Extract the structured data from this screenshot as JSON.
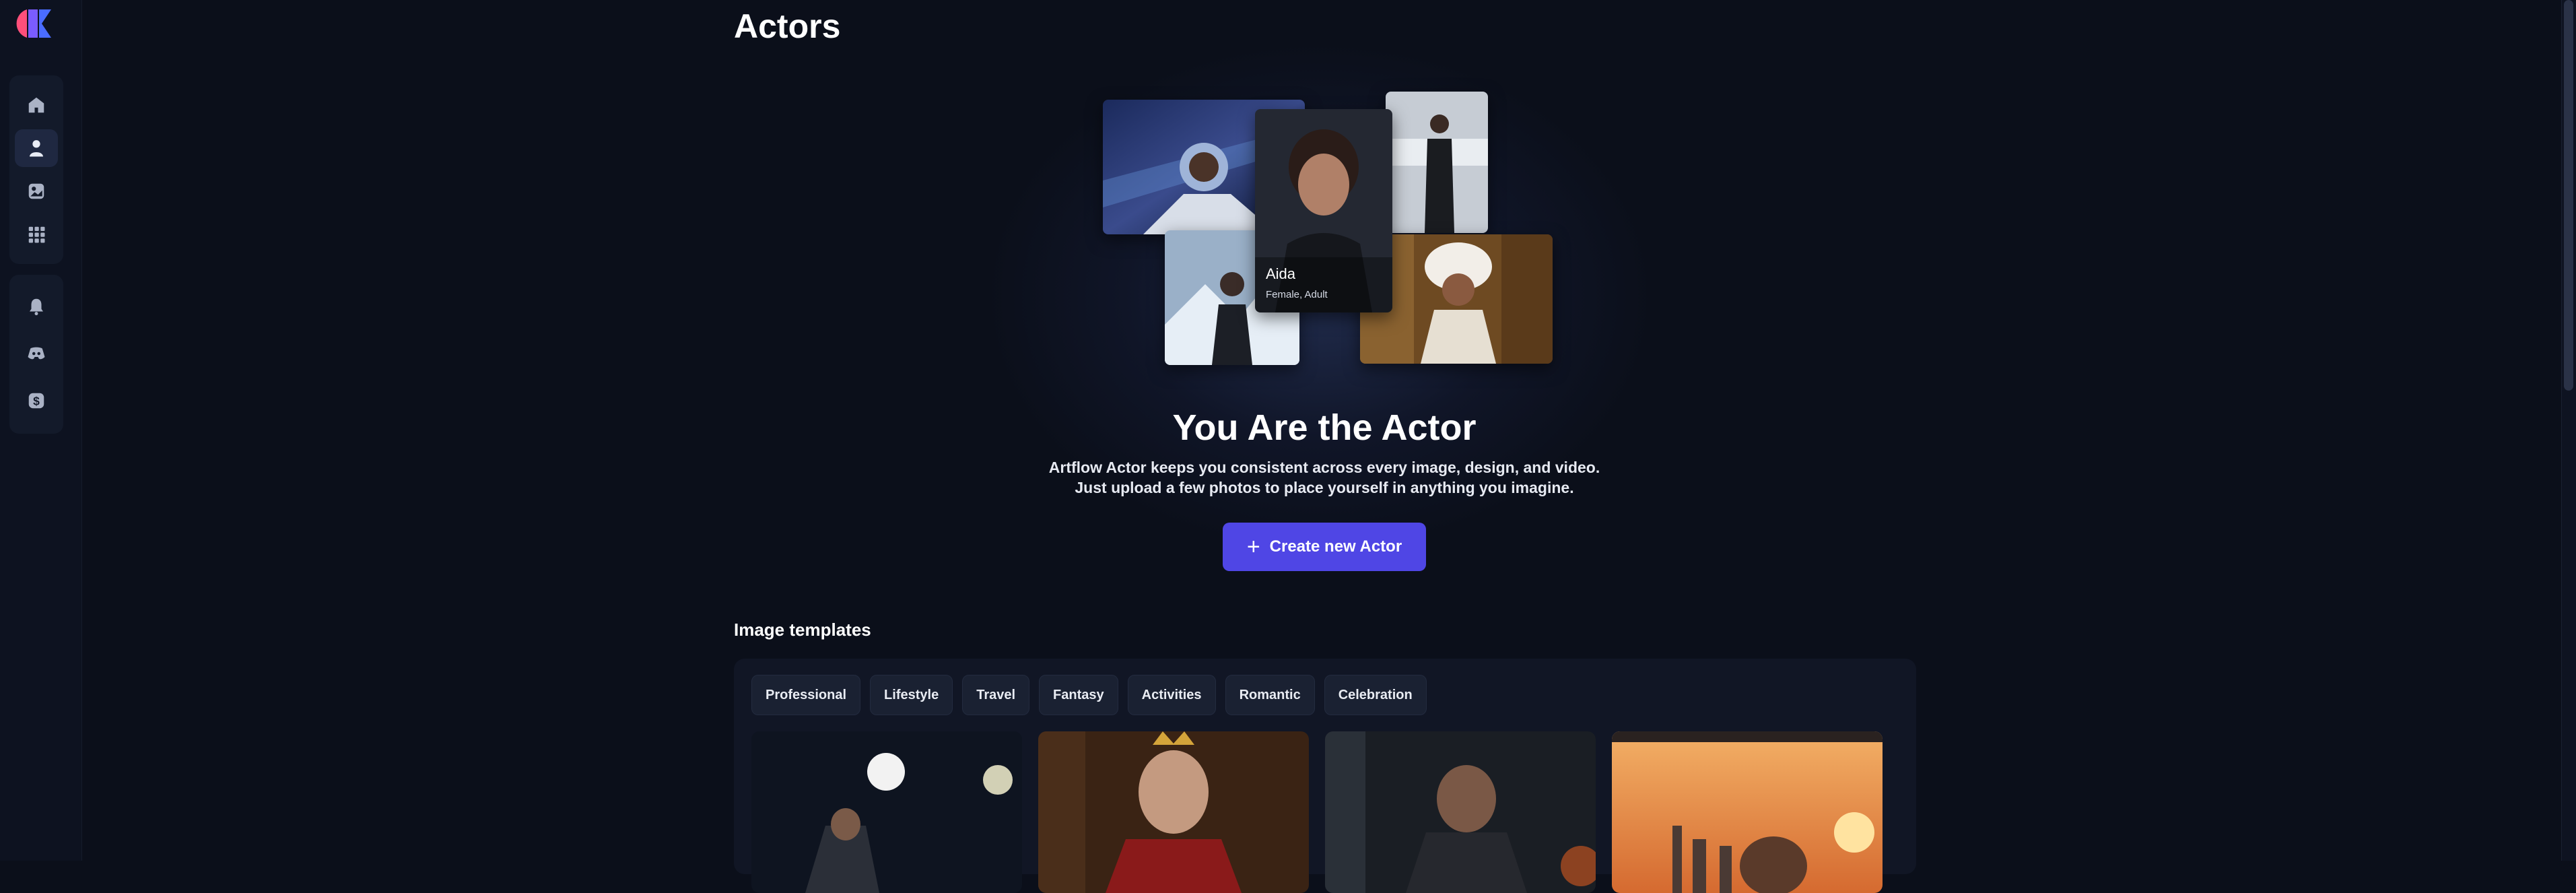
{
  "page": {
    "title": "Actors"
  },
  "sidebar": {
    "logo": "artflow-logo",
    "items": [
      {
        "icon": "home-icon",
        "active": false
      },
      {
        "icon": "user-icon",
        "active": true
      },
      {
        "icon": "gallery-icon",
        "active": false
      },
      {
        "icon": "apps-grid-icon",
        "active": false
      },
      {
        "icon": "bell-icon",
        "active": false
      },
      {
        "icon": "discord-icon",
        "active": false
      },
      {
        "icon": "dollar-icon",
        "active": false
      }
    ]
  },
  "hero": {
    "card_name": "Aida",
    "card_meta": "Female, Adult",
    "title": "You Are the Actor",
    "subtitle_line1": "Artflow Actor keeps you consistent across every image, design, and video.",
    "subtitle_line2": "Just upload a few photos to place yourself in anything you imagine.",
    "button_label": "Create new Actor",
    "button_icon": "plus-icon"
  },
  "templates": {
    "title": "Image templates",
    "chips": [
      "Professional",
      "Lifestyle",
      "Travel",
      "Fantasy",
      "Activities",
      "Romantic",
      "Celebration"
    ]
  },
  "colors": {
    "background": "#0b0f1a",
    "sidebar": "#0d1220",
    "accent": "#4f46e5",
    "panel": "#111625"
  }
}
